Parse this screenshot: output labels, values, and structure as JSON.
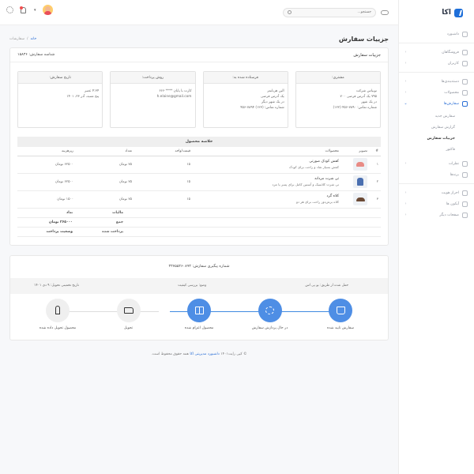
{
  "brand": {
    "name": "اکا"
  },
  "topbar": {
    "search_placeholder": "جستجو...",
    "notifications_count_visible": true
  },
  "sidebar": {
    "items": [
      {
        "label": "داشبورد",
        "has_children": false
      },
      {
        "label": "فروشگاهان",
        "has_children": true
      },
      {
        "label": "کاربران",
        "has_children": true
      },
      {
        "label": "دسته‌بندی‌ها",
        "has_children": true
      },
      {
        "label": "محصولات",
        "has_children": true
      },
      {
        "label": "سفارش‌ها",
        "has_children": true,
        "active": true
      },
      {
        "label": "نظرات",
        "has_children": true
      },
      {
        "label": "برندها",
        "has_children": false
      },
      {
        "label": "احراز هویت",
        "has_children": true
      },
      {
        "label": "آیکون ها",
        "has_children": true
      },
      {
        "label": "صفحات دیگر",
        "has_children": true
      }
    ],
    "orders_submenu": [
      "سفارش جدید",
      "گزارش سفارش",
      "جزییات سفارش",
      "فاکتور"
    ]
  },
  "page": {
    "title": "جزییات سفارش",
    "breadcrumb": {
      "home": "خانه",
      "separator": "/",
      "current": "سفارشات"
    }
  },
  "order_card": {
    "title": "جزییات سفارش",
    "order_id": "شناسه سفارش: ۱۵۸۳۶",
    "info": [
      {
        "heading": "مشتری:",
        "lines": [
          "توبیاس شرکت",
          "۷۹۵ یک آدرس فرضی ۷۰۰",
          "در یک شهر",
          "شماره تماس: ۷۸۹۰-۴۵۶ (۱۲۳)"
        ]
      },
      {
        "heading": "فرستاده شده به:",
        "lines": [
          "الین هرنانمز",
          "یک آدرس فرضی",
          "در یک شهر دیگر",
          "شماره تماس: (۱۲۳) ۷۸۹۴-۴۵۶"
        ]
      },
      {
        "heading": "روش پرداخت:",
        "lines": [
          "کارت با پایان **** ۶۶۶",
          "h.elaine@gmail.com"
        ]
      },
      {
        "heading": "تاریخ سفارش:",
        "lines": [
          "۴:۳۴ عصر",
          "پنج شنبه، آذر ۲۳، ۱۴۰۱"
        ]
      }
    ],
    "summary": {
      "title": "خلاصه محصول",
      "columns": [
        "#",
        "تصویر",
        "محصولات",
        "قیمت/واحد",
        "تعداد",
        "ریزهزینه"
      ],
      "rows": [
        {
          "index": "۱",
          "thumb": "shoe",
          "name": "کفش کودک صورتی",
          "desc": "کفش بسیار شاد و راحت برای کودک",
          "unit_price": "۱۵",
          "qty": "۷۵ تومان",
          "subtotal": "۶۲۵۰۰ تومان"
        },
        {
          "index": "۲",
          "thumb": "hoodie",
          "name": "تی شرت مردانه",
          "desc": "تی شرت کلاسیک و آستین کامل برای پسر یا مرد",
          "unit_price": "۱۵",
          "qty": "۷۵ تومان",
          "subtotal": "۶۲۵۰۰ تومان"
        },
        {
          "index": "۳",
          "thumb": "hat",
          "name": "کلاه گرد",
          "desc": "کلاه برش‌دوز راحت برای هر دو",
          "unit_price": "۱۵",
          "qty": "۷۵ تومان",
          "subtotal": "۱۵۰۰ تومان"
        }
      ],
      "totals": [
        {
          "label": "تداد",
          "value": "مالیات"
        },
        {
          "label": "جمع",
          "value": "۲۶۵۰۰۰ تومان"
        },
        {
          "label": "وضعیت پرداخت",
          "value": "پرداخت شده"
        }
      ]
    }
  },
  "tracking": {
    "tracking_no": "شماره پیگیری سفارش: ۳۴۷۵۵۴۶۰۸۹۳",
    "carrier": "حمل شده از طریق: یو پی اس",
    "status": "وضع: بررسی کیفیت",
    "eta": "تاریخ تخمینی تحویل: ۹ دی ۱۴۰۱",
    "steps": [
      {
        "label": "سفارش تایید شده",
        "icon": "cart-icon",
        "done": true
      },
      {
        "label": "در حال پردازش سفارش",
        "icon": "process-icon",
        "done": true
      },
      {
        "label": "محصول اعزام شده",
        "icon": "gift-icon",
        "done": true
      },
      {
        "label": "تحویل",
        "icon": "truck-icon",
        "done": false
      },
      {
        "label": "محصول تحویل داده شده",
        "icon": "person-icon",
        "done": false
      }
    ]
  },
  "footer": {
    "prefix": "© کپی رایت۱۴۰۱",
    "link": "داشبورد مدیریتی اکا",
    "suffix": "همه حقوق محفوظ است."
  },
  "colors": {
    "accent": "#2b6fd6",
    "step_done": "#4e8ee5"
  }
}
